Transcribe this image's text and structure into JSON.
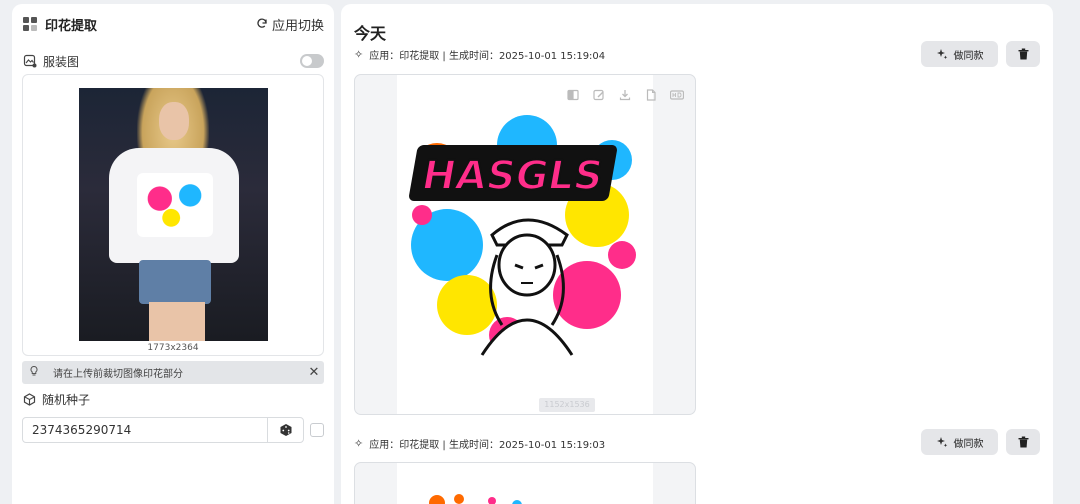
{
  "left_panel": {
    "title": "印花提取",
    "switch_app": "应用切换",
    "garment_label": "服装图",
    "image_size": "1773x2364",
    "tip": "请在上传前裁切图像印花部分",
    "seed_label": "随机种子",
    "seed_value": "2374365290714"
  },
  "right_panel": {
    "section_title": "今天",
    "results": [
      {
        "meta": "应用：印花提取 | 生成时间：2025-10-01 15:19:04",
        "same_button": "做同款",
        "image_size": "1152x1536",
        "print_text": "HASGLS"
      },
      {
        "meta": "应用：印花提取 | 生成时间：2025-10-01 15:19:03",
        "same_button": "做同款"
      }
    ]
  },
  "colors": {
    "pink": "#ff2d8a",
    "cyan": "#1fb7ff",
    "yellow": "#ffe600",
    "panel_bg": "#eef0f3"
  }
}
